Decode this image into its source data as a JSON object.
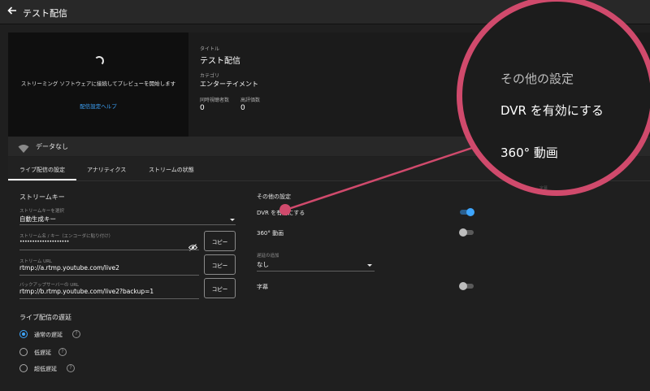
{
  "header": {
    "title": "テスト配信"
  },
  "preview": {
    "message": "ストリーミング ソフトウェアに接続してプレビューを開始します",
    "settings_help_link": "配信設定ヘルプ"
  },
  "info": {
    "title_label": "タイトル",
    "title_value": "テスト配信",
    "category_label": "カテゴリ",
    "category_value": "エンターテイメント",
    "concurrent_viewers_label": "同時視聴者数",
    "concurrent_viewers_value": "0",
    "likes_label": "高評価数",
    "likes_value": "0"
  },
  "status_bar": {
    "text": "データなし",
    "icon": "wifi-icon"
  },
  "tabs": [
    {
      "label": "ライブ配信の設定",
      "active": true
    },
    {
      "label": "アナリティクス",
      "active": false
    },
    {
      "label": "ストリームの状態",
      "active": false
    }
  ],
  "stream_key": {
    "section_title": "ストリームキー",
    "select_label": "ストリームキーを選択",
    "select_value": "自動生成キー",
    "name_label": "ストリーム名 / キー（エンコーダに貼り付け）",
    "name_value": "••••••••••••••••••••",
    "url_label": "ストリーム URL",
    "url_value": "rtmp://a.rtmp.youtube.com/live2",
    "backup_label": "バックアップサーバーの URL",
    "backup_value": "rtmp://b.rtmp.youtube.com/live2?backup=1",
    "copy_label": "コピー"
  },
  "latency": {
    "section_title": "ライブ配信の遅延",
    "options": [
      {
        "label": "通常の遅延",
        "selected": true
      },
      {
        "label": "低遅延",
        "selected": false
      },
      {
        "label": "超低遅延",
        "selected": false
      }
    ],
    "help_glyph": "?"
  },
  "other_settings": {
    "section_title": "その他の設定",
    "dvr_label": "DVR を有効にする",
    "dvr_enabled": true,
    "video360_label": "360° 動画",
    "video360_enabled": false,
    "delay_label": "遅延の追加",
    "delay_value": "なし",
    "captions_label": "字幕",
    "captions_enabled": false
  },
  "zoom_callout": {
    "section_title": "その他の設定",
    "dvr_label": "DVR を有効にする",
    "video360_label": "360° 動画",
    "faint_text": "字幕"
  },
  "colors": {
    "accent_blue": "#3ea6ff",
    "callout_pink": "#d04a6c",
    "background": "#1f1f1f"
  }
}
